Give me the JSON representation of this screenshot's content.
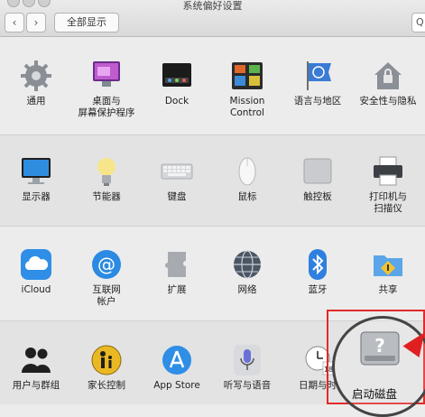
{
  "window": {
    "title": "系统偏好设置"
  },
  "toolbar": {
    "show_all_label": "全部显示",
    "back_glyph": "‹",
    "forward_glyph": "›",
    "search_glyph": "Q"
  },
  "rows": [
    {
      "panes": [
        {
          "name": "general-pane",
          "icon": "gear-icon",
          "label": [
            "通用"
          ]
        },
        {
          "name": "desktop-pane",
          "icon": "desktop-screensaver-icon",
          "label": [
            "桌面与",
            "屏幕保护程序"
          ]
        },
        {
          "name": "dock-pane",
          "icon": "dock-icon",
          "label": [
            "Dock"
          ]
        },
        {
          "name": "mission-control-pane",
          "icon": "mission-control-icon",
          "label": [
            "Mission",
            "Control"
          ]
        },
        {
          "name": "language-region-pane",
          "icon": "un-flag-icon",
          "label": [
            "语言与地区"
          ]
        },
        {
          "name": "security-privacy-pane",
          "icon": "house-lock-icon",
          "label": [
            "安全性与隐私"
          ]
        }
      ]
    },
    {
      "panes": [
        {
          "name": "displays-pane",
          "icon": "monitor-icon",
          "label": [
            "显示器"
          ]
        },
        {
          "name": "energy-saver-pane",
          "icon": "lightbulb-icon",
          "label": [
            "节能器"
          ]
        },
        {
          "name": "keyboard-pane",
          "icon": "keyboard-icon",
          "label": [
            "键盘"
          ]
        },
        {
          "name": "mouse-pane",
          "icon": "mouse-icon",
          "label": [
            "鼠标"
          ]
        },
        {
          "name": "trackpad-pane",
          "icon": "trackpad-icon",
          "label": [
            "触控板"
          ]
        },
        {
          "name": "printers-scanners-pane",
          "icon": "printer-icon",
          "label": [
            "打印机与",
            "扫描仪"
          ]
        }
      ]
    },
    {
      "panes": [
        {
          "name": "icloud-pane",
          "icon": "cloud-icon",
          "label": [
            "iCloud"
          ]
        },
        {
          "name": "internet-accounts-pane",
          "icon": "at-sign-icon",
          "label": [
            "互联网",
            "帐户"
          ]
        },
        {
          "name": "extensions-pane",
          "icon": "puzzle-icon",
          "label": [
            "扩展"
          ]
        },
        {
          "name": "network-pane",
          "icon": "globe-icon",
          "label": [
            "网络"
          ]
        },
        {
          "name": "bluetooth-pane",
          "icon": "bluetooth-icon",
          "label": [
            "蓝牙"
          ]
        },
        {
          "name": "sharing-pane",
          "icon": "sharing-folder-icon",
          "label": [
            "共享"
          ]
        }
      ]
    },
    {
      "panes": [
        {
          "name": "users-groups-pane",
          "icon": "users-icon",
          "label": [
            "用户与群组"
          ]
        },
        {
          "name": "parental-controls-pane",
          "icon": "parental-icon",
          "label": [
            "家长控制"
          ]
        },
        {
          "name": "app-store-pane",
          "icon": "app-store-icon",
          "label": [
            "App Store"
          ]
        },
        {
          "name": "dictation-speech-pane",
          "icon": "microphone-icon",
          "label": [
            "听写与语音"
          ]
        },
        {
          "name": "date-time-pane",
          "icon": "clock-calendar-icon",
          "label": [
            "日期与时"
          ]
        }
      ]
    }
  ],
  "highlight": {
    "label": "启动磁盘",
    "icon": "hard-disk-icon"
  },
  "calendar_day": "18"
}
